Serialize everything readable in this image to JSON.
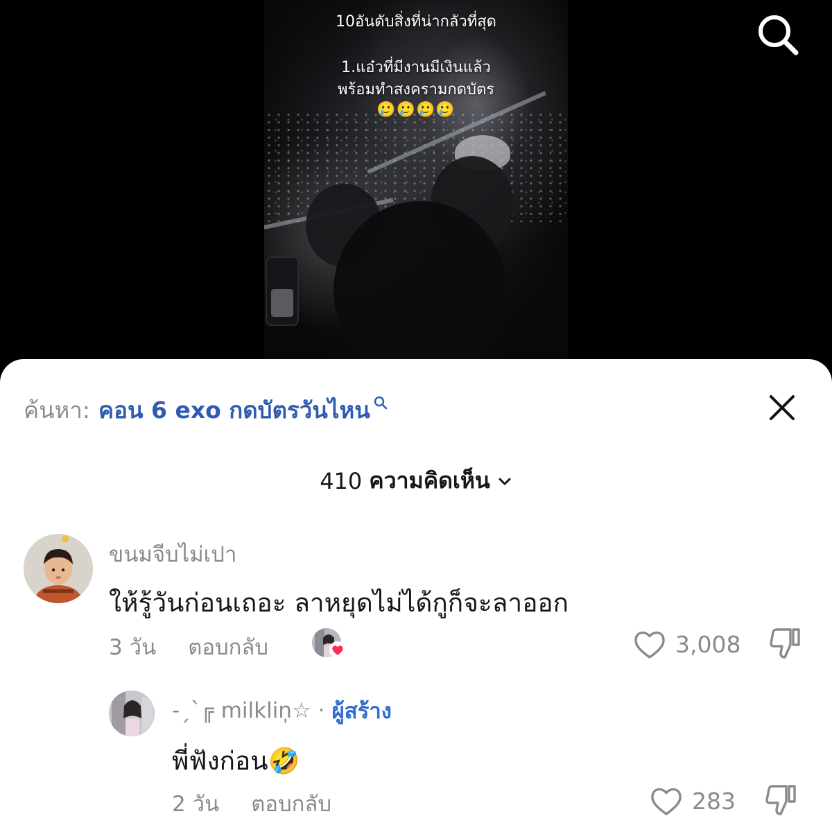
{
  "video": {
    "overlay_title": "10อันดับสิ่งที่น่ากลัวที่สุด",
    "overlay_line1": "1.แอ๋วที่มีงานมีเงินแล้ว",
    "overlay_line2": "พร้อมทำสงครามกดบัตร",
    "overlay_emojis": "🥲🥲🥲🥲"
  },
  "top_bar": {
    "search_icon": "search-icon"
  },
  "comments_sheet": {
    "search_prefix": "ค้นหา:",
    "search_query": "คอน 6 exo กดบัตรวันไหน",
    "close_icon": "close-icon",
    "comment_count": "410",
    "comment_count_label": "ความคิดเห็น",
    "comments": [
      {
        "username": "ขนมจีบไม่เปา",
        "text": "ให้รู้วันก่อนเถอะ ลาหยุดไม่ได้กูก็จะลาออก",
        "time": "3 วัน",
        "reply_label": "ตอบกลับ",
        "likes": "3,008",
        "liked_by_creator": true
      }
    ],
    "replies": [
      {
        "username": "-ˏˋ╔ milklin̩̩☆",
        "separator": "·",
        "creator_tag": "ผู้สร้าง",
        "text": "พี่ฟังก่อน",
        "emoji": "🤣",
        "time": "2 วัน",
        "reply_label": "ตอบกลับ",
        "likes": "283"
      }
    ]
  },
  "colors": {
    "link_blue": "#2f5cb1",
    "creator_blue": "#2f6bd0",
    "heart_red": "#fe2c55",
    "muted_gray": "#8a8a8a"
  }
}
